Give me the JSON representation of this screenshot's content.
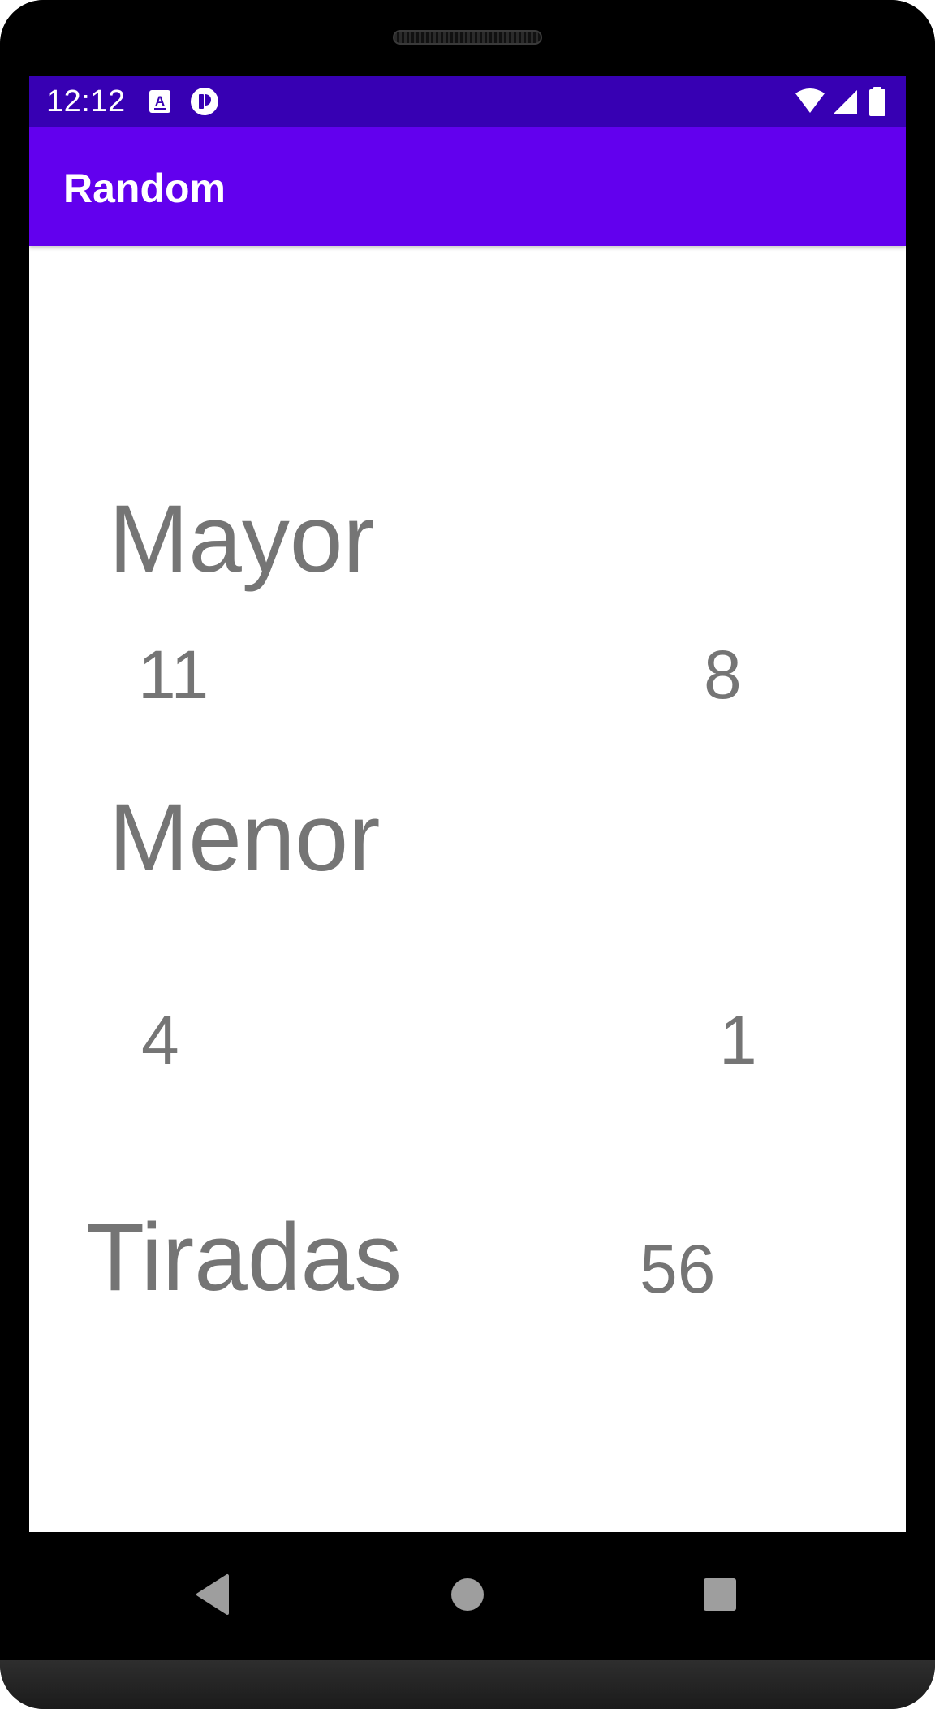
{
  "status_bar": {
    "time": "12:12",
    "background": "#3700b3",
    "left_icons": [
      "accessibility-a-icon",
      "app-t-icon"
    ],
    "right_icons": [
      "wifi-icon",
      "cellular-signal-icon",
      "battery-icon"
    ]
  },
  "app_bar": {
    "title": "Random",
    "background": "#6200ee"
  },
  "main": {
    "mayor": {
      "label": "Mayor",
      "left_value": "11",
      "right_value": "8"
    },
    "menor": {
      "label": "Menor",
      "left_value": "4",
      "right_value": "1"
    },
    "tiradas": {
      "label": "Tiradas",
      "value": "56"
    },
    "text_color": "#757575"
  },
  "nav_bar": {
    "buttons": [
      "back-icon",
      "home-icon",
      "recents-icon"
    ]
  }
}
